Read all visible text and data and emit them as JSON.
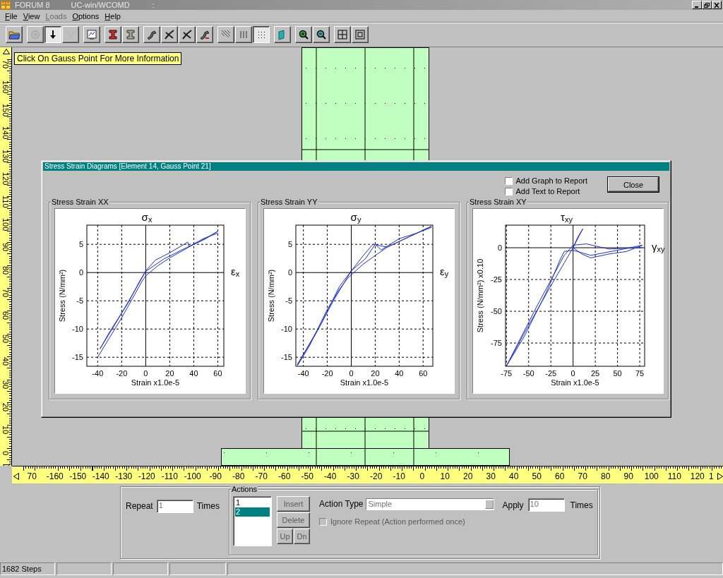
{
  "window": {
    "title": "FORUM 8",
    "subtitle": "UC-win/WCOMD",
    "suffix": ":"
  },
  "menu": [
    {
      "label": "File",
      "disabled": false
    },
    {
      "label": "View",
      "disabled": false
    },
    {
      "label": "Loads",
      "disabled": true
    },
    {
      "label": "Options",
      "disabled": false
    },
    {
      "label": "Help",
      "disabled": false
    }
  ],
  "toolbar": {
    "groups": [
      [
        {
          "kind": "folder",
          "pressed": false,
          "disabled": false
        }
      ],
      [
        {
          "kind": "gear",
          "pressed": false,
          "disabled": true
        },
        {
          "kind": "arrow",
          "pressed": true,
          "disabled": false
        },
        {
          "kind": "wave",
          "pressed": false,
          "disabled": true
        }
      ],
      [
        {
          "kind": "monitor",
          "pressed": false,
          "disabled": false
        }
      ],
      [
        {
          "kind": "ibeam-red",
          "pressed": false,
          "disabled": false
        },
        {
          "kind": "ibeam",
          "pressed": false,
          "disabled": false
        }
      ],
      [
        {
          "kind": "bent",
          "pressed": false,
          "disabled": false
        },
        {
          "kind": "cracked",
          "pressed": false,
          "disabled": false
        },
        {
          "kind": "cracked",
          "pressed": false,
          "disabled": false
        },
        {
          "kind": "bent-red",
          "pressed": false,
          "disabled": false
        }
      ],
      [
        {
          "kind": "hatch",
          "pressed": false,
          "disabled": false
        },
        {
          "kind": "vlines",
          "pressed": false,
          "disabled": false
        },
        {
          "kind": "dots",
          "pressed": true,
          "disabled": false
        }
      ],
      [
        {
          "kind": "panel",
          "pressed": false,
          "disabled": false
        }
      ],
      [
        {
          "kind": "zoom-in",
          "pressed": false,
          "disabled": false
        },
        {
          "kind": "zoom-out",
          "pressed": false,
          "disabled": false
        }
      ],
      [
        {
          "kind": "grid",
          "pressed": false,
          "disabled": false
        },
        {
          "kind": "frame",
          "pressed": false,
          "disabled": false
        }
      ]
    ]
  },
  "hint": "Click On Gauss Point For More Information",
  "rulers": {
    "vertical": [
      "70",
      "160",
      "150",
      "140",
      "130",
      "120",
      "110",
      "100",
      "90",
      "80",
      "70",
      "60",
      "50",
      "40",
      "30",
      "20",
      "10",
      "0"
    ],
    "horizontal": [
      "70",
      "-160",
      "-150",
      "-140",
      "-130",
      "-120",
      "-110",
      "-100",
      "-90",
      "-80",
      "-70",
      "-60",
      "-50",
      "-40",
      "-30",
      "-20",
      "-10",
      "0",
      "10",
      "20",
      "30",
      "40",
      "50",
      "60",
      "70",
      "80",
      "90",
      "100",
      "110",
      "120",
      "1"
    ]
  },
  "dialog": {
    "title": "Stress Strain Diagrams  [Element 14, Gauss Point 21]",
    "options": [
      {
        "label": "Add Graph to Report",
        "checked": false
      },
      {
        "label": "Add Text to Report",
        "checked": false
      }
    ],
    "close_button": "Close",
    "panels": [
      {
        "group_label": "Stress Strain XX",
        "axis_symbol": "ε$_{x}$",
        "chart_data": {
          "type": "line",
          "title": "σ$_{x}$",
          "xlabel": "Strain  x1.0e-5",
          "ylabel": "Stress (N/mm²)",
          "grid": true,
          "xlim": [
            -49,
            65
          ],
          "ylim": [
            -16.6,
            8.4
          ],
          "xticks": [
            -40,
            -20,
            0,
            20,
            40,
            60
          ],
          "yticks": [
            -15,
            -10,
            -5,
            0,
            5
          ],
          "x": [
            -40,
            -30,
            -20,
            -10,
            -3,
            0,
            10,
            20,
            30,
            40,
            50,
            60,
            45,
            30,
            15,
            0,
            -10,
            -25,
            -38,
            -30,
            -15,
            -5,
            0,
            8,
            20,
            35,
            36,
            48,
            60
          ],
          "series": [
            {
              "color": "#1f2fd0",
              "values": [
                -15,
                -11.5,
                -8,
                -4.2,
                -1.5,
                -0.6,
                1.2,
                2.6,
                3.8,
                5,
                6,
                7.3,
                5.5,
                4,
                2.4,
                0.2,
                -3.5,
                -9,
                -13.5,
                -10.5,
                -5.5,
                -1.5,
                0.3,
                2.2,
                3.5,
                5.4,
                4.6,
                6,
                7
              ]
            }
          ]
        }
      },
      {
        "group_label": "Stress Strain YY",
        "axis_symbol": "ε$_{y}$",
        "chart_data": {
          "type": "line",
          "title": "σ$_{y}$",
          "xlabel": "Strain  x1.0e-5",
          "ylabel": "Stress (N/mm²)",
          "grid": true,
          "xlim": [
            -46.3,
            68.1
          ],
          "ylim": [
            -16.6,
            8.4
          ],
          "xticks": [
            -40,
            -20,
            0,
            20,
            40,
            60
          ],
          "yticks": [
            -15,
            -10,
            -5,
            0,
            5
          ],
          "x": [
            -45,
            -35,
            -20,
            -10,
            -3,
            0,
            10,
            20,
            30,
            40,
            50,
            67,
            45,
            30,
            18,
            10,
            0,
            -10,
            -25,
            -45,
            -30,
            -15,
            -5,
            0,
            12,
            20,
            25,
            40,
            55,
            67
          ],
          "series": [
            {
              "color": "#1f2fd0",
              "values": [
                -16.5,
                -13,
                -6.5,
                -3,
                -1,
                -0.4,
                1.5,
                3,
                4.5,
                5.5,
                6.5,
                8.2,
                6,
                4.5,
                5,
                3,
                0.3,
                -2.5,
                -9,
                -16.3,
                -11,
                -5,
                -1.5,
                0.3,
                2.5,
                5,
                4,
                6,
                7,
                8
              ]
            }
          ]
        }
      },
      {
        "group_label": "Stress Strain XY",
        "axis_symbol": "γ$_{xy}$",
        "chart_data": {
          "type": "line",
          "title": "τ$_{xy}$",
          "xlabel": "Strain  x1.0e-5",
          "ylabel": "Stress (N/mm²) x0.10",
          "grid": true,
          "xlim": [
            -76,
            80.5
          ],
          "ylim": [
            -93.3,
            17.8
          ],
          "xticks": [
            -75,
            -50,
            -25,
            0,
            25,
            50,
            75
          ],
          "yticks": [
            -75,
            -50,
            -25,
            0
          ],
          "x": [
            -75,
            -50,
            -25,
            -10,
            0,
            5,
            11,
            0,
            10,
            20,
            40,
            60,
            78,
            50,
            20,
            0,
            -10,
            -15,
            -30,
            -55,
            -75,
            -40,
            -10,
            0,
            15,
            40,
            78
          ],
          "series": [
            {
              "color": "#1f2fd0",
              "values": [
                -93,
                -61,
                -30,
                -12,
                0,
                8,
                15,
                0,
                -5,
                -8,
                -5,
                -3,
                2,
                -2,
                -6,
                -2,
                -3,
                -10,
                -35,
                -70,
                -93,
                -45,
                -6,
                2,
                3,
                -1,
                0
              ]
            }
          ]
        }
      }
    ]
  },
  "actions_panel": {
    "repeat": {
      "label": "Repeat",
      "value": "1",
      "unit": "Times",
      "disabled": true
    },
    "group_label": "Actions",
    "list": [
      {
        "label": "1",
        "selected": false
      },
      {
        "label": "2",
        "selected": true
      }
    ],
    "buttons": [
      {
        "label": "Insert",
        "disabled": true
      },
      {
        "label": "Delete",
        "disabled": true
      },
      {
        "label": "Up",
        "disabled": true
      },
      {
        "label": "Dn",
        "disabled": true
      }
    ],
    "action_type": {
      "label": "Action Type",
      "value": "Simple",
      "disabled": true
    },
    "apply": {
      "label": "Apply",
      "value": "10",
      "unit": "Times",
      "disabled": true
    },
    "ignore_repeat": {
      "label": "Ignore Repeat (Action performed once)",
      "checked": false,
      "disabled": true
    }
  },
  "status_bar": {
    "steps": "1682 Steps"
  }
}
